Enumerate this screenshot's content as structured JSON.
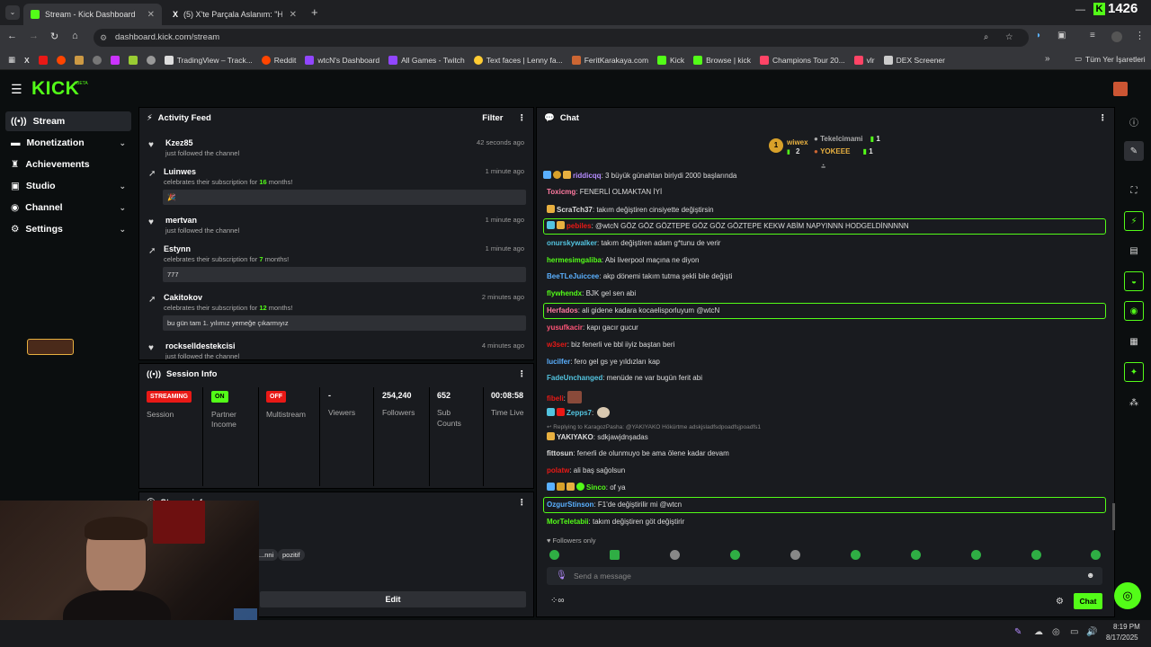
{
  "browser": {
    "tabs": [
      {
        "label": "Stream - Kick Dashboard",
        "active": true
      },
      {
        "label": "(5) X'te Parçala Aslanım: \"Henüz",
        "active": false
      }
    ],
    "url": "dashboard.kick.com/stream",
    "bookmarks": [
      "TradingView – Track...",
      "Reddit",
      "wtcN's Dashboard",
      "All Games - Twitch",
      "Text faces | Lenny fa...",
      "FeritKarakaya.com",
      "Kick",
      "Browse | kick",
      "Champions Tour 20...",
      "vlr",
      "DEX Screener"
    ],
    "all_bookmarks": "Tüm Yer İşaretleri",
    "corner_count": "1426"
  },
  "kick": {
    "logo": "KICK",
    "logo_tag": "BETA"
  },
  "sidebar": {
    "items": [
      {
        "label": "Stream",
        "icon": "broadcast-icon",
        "active": true
      },
      {
        "label": "Monetization",
        "icon": "money-icon",
        "expandable": true
      },
      {
        "label": "Achievements",
        "icon": "trophy-icon"
      },
      {
        "label": "Studio",
        "icon": "studio-icon",
        "expandable": true
      },
      {
        "label": "Channel",
        "icon": "user-icon",
        "expandable": true
      },
      {
        "label": "Settings",
        "icon": "gear-icon",
        "expandable": true
      }
    ]
  },
  "activity": {
    "title": "Activity Feed",
    "filter_label": "Filter",
    "items": [
      {
        "name": "Kzez85",
        "text": "just followed the channel",
        "time": "42 seconds ago",
        "icon": "heart-icon"
      },
      {
        "name": "Luinwes",
        "text_pre": "celebrates their subscription for ",
        "months": "16",
        "text_post": " months!",
        "time": "1 minute ago",
        "icon": "sub-icon",
        "message": "🎉"
      },
      {
        "name": "mertvan",
        "text": "just followed the channel",
        "time": "1 minute ago",
        "icon": "heart-icon"
      },
      {
        "name": "Estynn",
        "text_pre": "celebrates their subscription for ",
        "months": "7",
        "text_post": " months!",
        "time": "1 minute ago",
        "icon": "sub-icon",
        "message": "777"
      },
      {
        "name": "Cakitokov",
        "text_pre": "celebrates their subscription for ",
        "months": "12",
        "text_post": " months!",
        "time": "2 minutes ago",
        "icon": "sub-icon",
        "message": "bu gün tam 1. yılımız yemeğe çıkarmıyız"
      },
      {
        "name": "rockselldestekcisi",
        "text": "just followed the channel",
        "time": "4 minutes ago",
        "icon": "heart-icon"
      }
    ]
  },
  "session": {
    "title": "Session Info",
    "badges": [
      {
        "badge": "STREAMING",
        "label": "Session",
        "color": "#e91916"
      },
      {
        "badge": "ON",
        "label": "Partner Income",
        "color": "#53fc18"
      },
      {
        "badge": "OFF",
        "label": "Multistream",
        "color": "#e91916"
      }
    ],
    "stats": [
      {
        "value": "-",
        "label": "Viewers"
      },
      {
        "value": "254,240",
        "label": "Followers"
      },
      {
        "value": "652",
        "label": "Sub Counts"
      },
      {
        "value": "00:08:58",
        "label": "Time Live"
      }
    ]
  },
  "stream_info": {
    "title": "Stream info",
    "tags": [
      "...nni",
      "pozitif"
    ],
    "edit_label": "Edit"
  },
  "chat": {
    "title": "Chat",
    "top": [
      {
        "name": "wiwex",
        "count": "2",
        "rank": "1"
      },
      {
        "name": "Tekelcimami",
        "count": "1"
      },
      {
        "name": "YOKEEE",
        "count": "1"
      }
    ],
    "messages": [
      {
        "user": "riddicqq",
        "color": "#b58cff",
        "text": ": 3 büyük günahtan biriydi 2000 başlarında"
      },
      {
        "user": "Toxicmg",
        "color": "#ff7aa0",
        "text": ": FENERLİ OLMAKTAN İYİ"
      },
      {
        "user": "ScraTch37",
        "color": "#ddd",
        "text": ": takım değiştiren cinsiyette değiştirsin"
      },
      {
        "user": "pebiles",
        "color": "#e91916",
        "text": ": @wtcN GÖZ GÖZ GÖZTEPE GÖZ GÖZ GÖZTEPE KEKW ABİM NAPYINNN HODGELDİNNNNN",
        "highlight": true
      },
      {
        "user": "onurskywalker",
        "color": "#53c4e0",
        "text": ": takım değiştiren adam g*tunu de verir"
      },
      {
        "user": "hermesimgaliba",
        "color": "#53fc18",
        "text": ": Abi liverpool maçına ne diyon"
      },
      {
        "user": "BeeTLeJuiccee",
        "color": "#5ab0ff",
        "text": ": akp dönemi takım tutma şekli bile değişti"
      },
      {
        "user": "flywhendx",
        "color": "#53fc18",
        "text": ": BJK gel sen abi"
      },
      {
        "user": "Herfados",
        "color": "#ff7aa0",
        "text": ": ali gidene kadara kocaelisporluyum @wtcN",
        "highlight": true
      },
      {
        "user": "yusufkacir",
        "color": "#ff5577",
        "text": ": kapı gacır gucur"
      },
      {
        "user": "w3ser",
        "color": "#e91916",
        "text": ": biz fenerli ve bbl iiyiz baştan beri"
      },
      {
        "user": "lucilfer",
        "color": "#5ab0ff",
        "text": ": fero gel gs ye yıldızları kap"
      },
      {
        "user": "FadeUnchanged",
        "color": "#53c4e0",
        "text": ": menüde ne var bugün ferit abi"
      },
      {
        "user": "fibeli",
        "color": "#e91916",
        "text": ":"
      },
      {
        "user": "Zepps7",
        "color": "#53c4e0",
        "text": ":"
      },
      {
        "user": "Replying to KaragozPasha: @YAKIYAKO Hökürtme adskjsladfsdpoadfsjpoadfs1",
        "color": "#888",
        "text": "",
        "reply": true
      },
      {
        "user": "YAKIYAKO",
        "color": "#ddd",
        "text": ": sdkjawjdnşadas"
      },
      {
        "user": "fittosun",
        "color": "#ddd",
        "text": ": fenerli de olunmuyo be ama ölene kadar devam"
      },
      {
        "user": "polatw",
        "color": "#e91916",
        "text": ": ali baş sağolsun"
      },
      {
        "user": "Sinco",
        "color": "#53fc18",
        "text": ": of ya"
      },
      {
        "user": "OzgurStinson",
        "color": "#5ab0ff",
        "text": ": F1'de değiştirilir mi @wtcn",
        "highlight": true
      },
      {
        "user": "MorTeletabii",
        "color": "#53fc18",
        "text": ": takım değiştiren göt değiştirir"
      }
    ],
    "followers_only": "Followers only",
    "input_placeholder": "Send a message",
    "send_label": "Chat"
  },
  "taskbar": {
    "time": "8:19 PM",
    "date": "8/17/2025"
  },
  "colors": {
    "accent": "#53fc18",
    "panel": "#191b1f",
    "bg": "#0b0e0f"
  }
}
